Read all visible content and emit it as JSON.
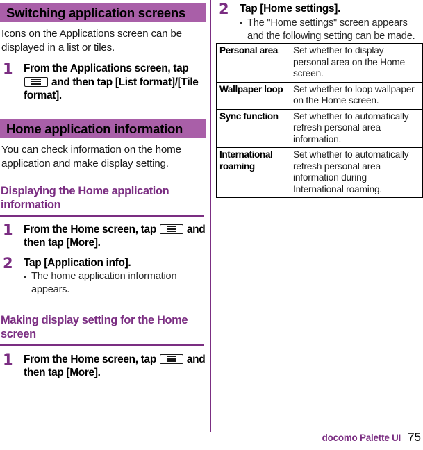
{
  "page": {
    "number": "75",
    "brand": "docomo Palette UI"
  },
  "left_column": {
    "section1": {
      "banner": "Switching application screens",
      "intro": "Icons on the Applications screen can be displayed in a list or tiles.",
      "steps": [
        {
          "number": "1",
          "title_before_icon": "From the Applications screen, tap",
          "icon": "menu-key-icon",
          "title_after_icon": "and then tap [List format]/[Tile format]."
        }
      ]
    },
    "section2": {
      "banner": "Home application information",
      "intro": "You can check information on the home application and make display setting.",
      "subsection1": {
        "heading": "Displaying the Home application information",
        "steps": [
          {
            "number": "1",
            "title_before_icon": "From the Home screen, tap",
            "icon": "menu-key-icon",
            "title_after_icon": "and then tap [More]."
          },
          {
            "number": "2",
            "title": "Tap [Application info].",
            "bullets": [
              "The home application information appears."
            ]
          }
        ]
      },
      "subsection2": {
        "heading": "Making display setting for the Home screen",
        "steps": [
          {
            "number": "1",
            "title_before_icon": "From the Home screen, tap",
            "icon": "menu-key-icon",
            "title_after_icon": "and then tap [More]."
          }
        ]
      }
    }
  },
  "right_column": {
    "step": {
      "number": "2",
      "title": "Tap [Home settings].",
      "bullets": [
        "The \"Home settings\" screen appears and the following setting can be made."
      ]
    },
    "table": {
      "rows": [
        {
          "key": "Personal area",
          "value": "Set whether to display personal area on the Home screen."
        },
        {
          "key": "Wallpaper loop",
          "value": "Set whether to loop wallpaper on the Home screen."
        },
        {
          "key": "Sync function",
          "value": "Set whether to automatically refresh personal area information."
        },
        {
          "key": "International roaming",
          "value": "Set whether to automatically refresh personal area information during International roaming."
        }
      ]
    }
  },
  "colors": {
    "banner_purple": "#A95FA8",
    "accent_purple": "#7B2E82",
    "text_black": "#000000"
  }
}
